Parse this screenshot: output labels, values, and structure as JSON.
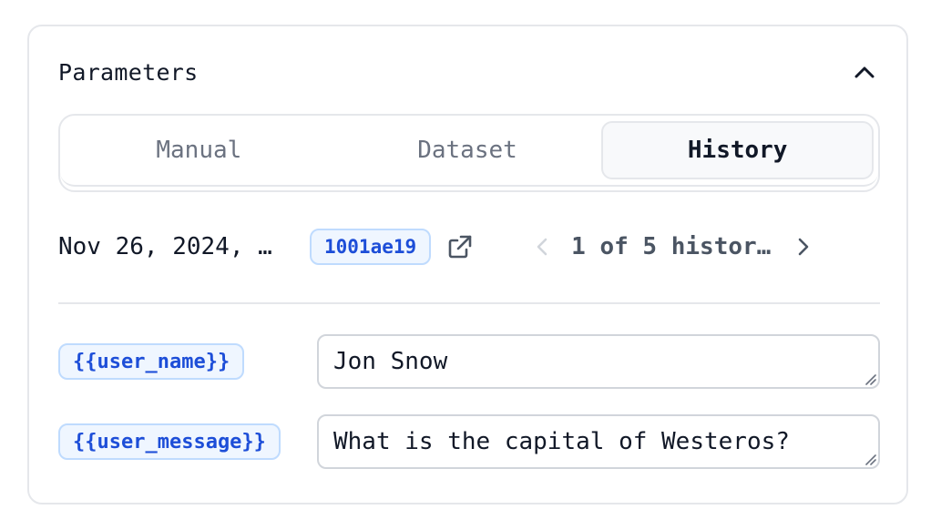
{
  "panel": {
    "title": "Parameters",
    "collapse_icon": "chevron-up-icon"
  },
  "tabs": [
    {
      "label": "Manual",
      "active": false
    },
    {
      "label": "Dataset",
      "active": false
    },
    {
      "label": "History",
      "active": true
    }
  ],
  "history": {
    "date": "Nov 26, 2024, …",
    "hash": "1001ae19",
    "external_icon": "external-link-icon",
    "pager_text": "1 of 5 histor…",
    "prev_icon": "chevron-left-icon",
    "next_icon": "chevron-right-icon"
  },
  "params": [
    {
      "name": "{{user_name}}",
      "value": "Jon Snow"
    },
    {
      "name": "{{user_message}}",
      "value": "What is the capital of Westeros?"
    }
  ],
  "colors": {
    "accent": "#1d4ed8",
    "badge_bg": "#eff6ff",
    "border": "#e5e7eb",
    "muted_text": "#6b7280"
  }
}
